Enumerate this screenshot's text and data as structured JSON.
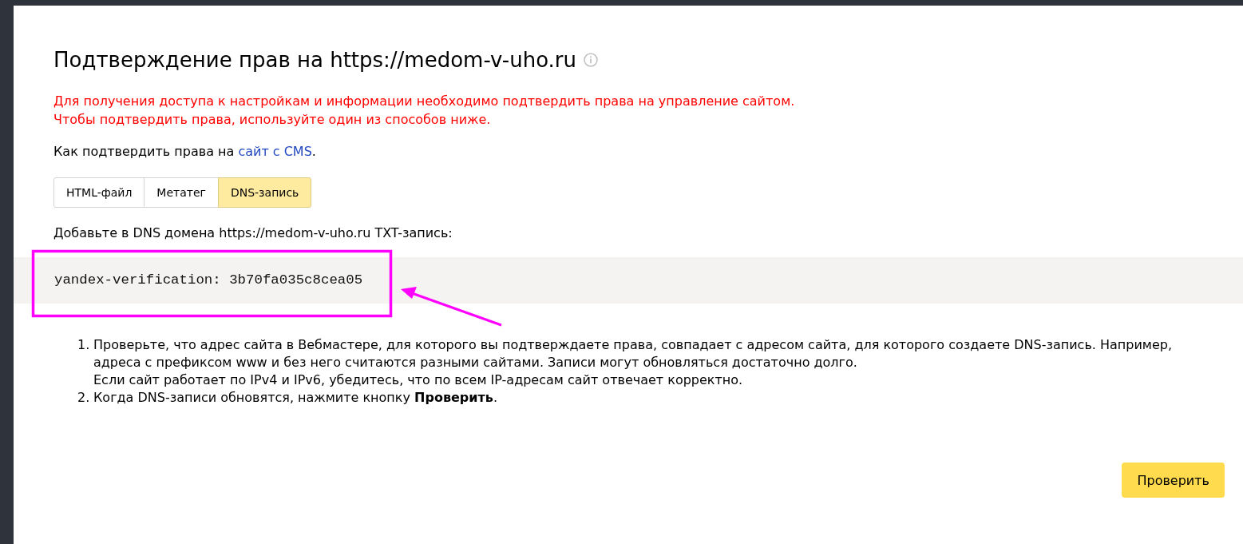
{
  "title": "Подтверждение прав на https://medom-v-uho.ru",
  "warning": [
    "Для получения доступа к настройкам и информации необходимо подтвердить права на управление сайтом.",
    "Чтобы подтвердить права, используйте один из способов ниже."
  ],
  "cms_hint": {
    "text": "Как подтвердить права на",
    "link": "сайт с CMS",
    "after": "."
  },
  "tabs": [
    {
      "label": "HTML-файл",
      "selected": false
    },
    {
      "label": "Метатег",
      "selected": false
    },
    {
      "label": "DNS-запись",
      "selected": true
    }
  ],
  "instruction": "Добавьте в DNS домена https://medom-v-uho.ru TXT-запись:",
  "dns_record": "yandex-verification: 3b70fa035c8cea05",
  "steps": [
    {
      "number": "1.",
      "lines": [
        "Проверьте, что адрес сайта в Вебмастере, для которого вы подтверждаете права, совпадает с адресом сайта, для которого создаете DNS-запись. Например, адреса с префиксом www и без него считаются разными сайтами. Записи могут обновляться достаточно долго.",
        "Если сайт работает по IPv4 и IPv6, убедитесь, что по всем IP-адресам сайт отвечает корректно."
      ]
    },
    {
      "number": "2.",
      "lines": [
        "Когда DNS-записи обновятся, нажмите кнопку **Проверить**."
      ]
    }
  ],
  "check_button": "Проверить"
}
